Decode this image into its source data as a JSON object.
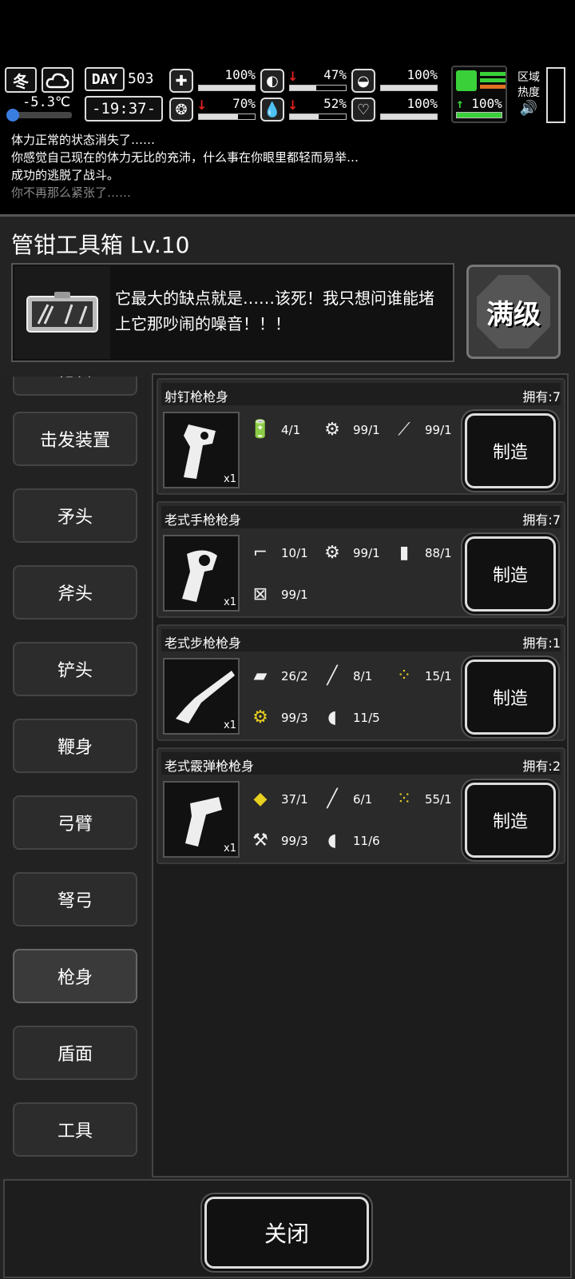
{
  "hud": {
    "season": "冬",
    "weather_icon": "cloud-icon",
    "temperature": "-5.3℃",
    "day_label": "DAY",
    "day_number": "503",
    "clock": "-19:37-",
    "stats": [
      {
        "name": "health",
        "icon": "medkit-icon",
        "value": "100%",
        "fill": 100,
        "down": false
      },
      {
        "name": "hunger",
        "icon": "stomach-icon",
        "value": "47%",
        "fill": 47,
        "down": true
      },
      {
        "name": "mental",
        "icon": "mask-icon",
        "value": "100%",
        "fill": 100,
        "down": false
      },
      {
        "name": "immunity",
        "icon": "shell-icon",
        "value": "70%",
        "fill": 70,
        "down": true
      },
      {
        "name": "thirst",
        "icon": "droplet-icon",
        "value": "52%",
        "fill": 52,
        "down": true
      },
      {
        "name": "mood",
        "icon": "heart-icon",
        "value": "100%",
        "fill": 100,
        "down": false
      }
    ],
    "stamina_value": "100%",
    "zone_label": "区域热度"
  },
  "log": [
    "体力正常的状态消失了……",
    "你感觉自己现在的体力无比的充沛，什么事在你眼里都轻而易举…",
    "成功的逃脱了战斗。",
    "你不再那么紧张了……"
  ],
  "panel": {
    "title": "管钳工具箱 Lv.10",
    "description": "它最大的缺点就是……该死！我只想问谁能堵上它那吵闹的噪音！！！",
    "max_label": "满级"
  },
  "sidebar": [
    {
      "label": "枪管"
    },
    {
      "label": "击发装置"
    },
    {
      "label": "矛头"
    },
    {
      "label": "斧头"
    },
    {
      "label": "铲头"
    },
    {
      "label": "鞭身"
    },
    {
      "label": "弓臂"
    },
    {
      "label": "弩弓"
    },
    {
      "label": "枪身"
    },
    {
      "label": "盾面"
    },
    {
      "label": "工具"
    }
  ],
  "recipes": [
    {
      "name": "射钉枪枪身",
      "owned": "拥有:7",
      "qty": "x1",
      "make": "制造",
      "materials": [
        {
          "icon": "battery-icon",
          "value": "4/1"
        },
        {
          "icon": "gears-icon",
          "value": "99/1"
        },
        {
          "icon": "wire-icon",
          "value": "99/1"
        }
      ]
    },
    {
      "name": "老式手枪枪身",
      "owned": "拥有:7",
      "qty": "x1",
      "make": "制造",
      "materials": [
        {
          "icon": "pistol-icon",
          "value": "10/1"
        },
        {
          "icon": "gears-icon",
          "value": "99/1"
        },
        {
          "icon": "canister-icon",
          "value": "88/1"
        },
        {
          "icon": "toolbox-icon",
          "value": "99/1"
        }
      ]
    },
    {
      "name": "老式步枪枪身",
      "owned": "拥有:1",
      "qty": "x1",
      "make": "制造",
      "materials": [
        {
          "icon": "metal-sheet-icon",
          "value": "26/2"
        },
        {
          "icon": "rifle-icon",
          "value": "8/1"
        },
        {
          "icon": "yellow-parts-icon",
          "value": "15/1"
        },
        {
          "icon": "yellow-gears-icon",
          "value": "99/3"
        },
        {
          "icon": "glue-icon",
          "value": "11/5"
        }
      ]
    },
    {
      "name": "老式霰弹枪枪身",
      "owned": "拥有:2",
      "qty": "x1",
      "make": "制造",
      "materials": [
        {
          "icon": "yellow-plate-icon",
          "value": "37/1"
        },
        {
          "icon": "rifle-icon",
          "value": "6/1"
        },
        {
          "icon": "yellow-scrap-icon",
          "value": "55/1"
        },
        {
          "icon": "tool-parts-icon",
          "value": "99/3"
        },
        {
          "icon": "glue-icon",
          "value": "11/6"
        }
      ]
    }
  ],
  "close_label": "关闭"
}
